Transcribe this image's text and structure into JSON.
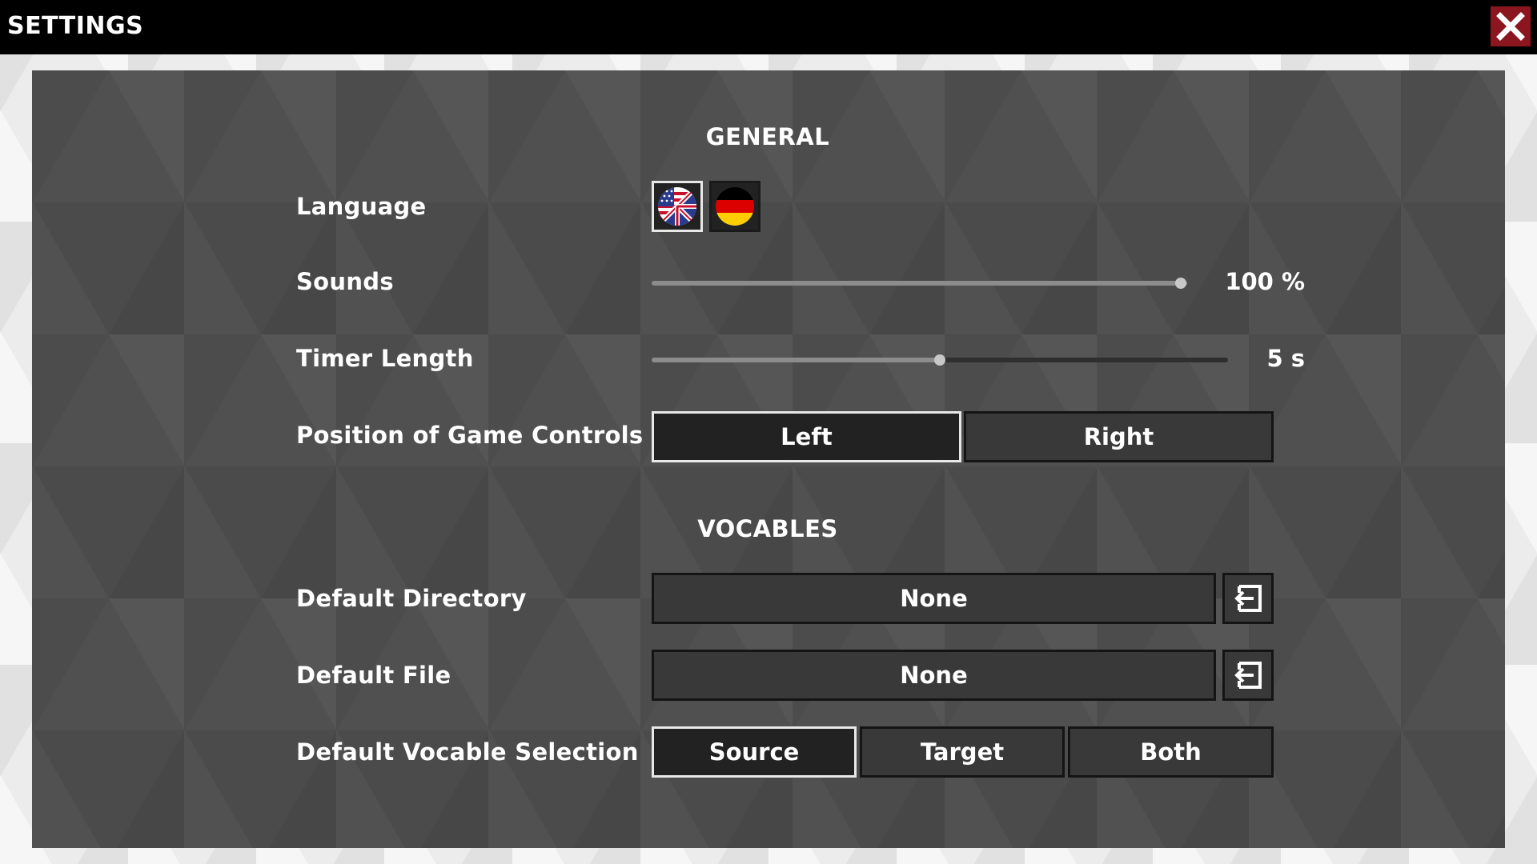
{
  "window": {
    "title": "SETTINGS",
    "close_icon": "close-icon",
    "close_color": "#8b1620"
  },
  "general": {
    "title": "GENERAL",
    "language": {
      "label": "Language",
      "options": [
        {
          "icon": "us-uk-flag-icon",
          "selected": true
        },
        {
          "icon": "german-flag-icon",
          "selected": false
        }
      ]
    },
    "sounds": {
      "label": "Sounds",
      "value_text": "100 %",
      "level": 1.0
    },
    "timer": {
      "label": "Timer Length",
      "value_text": "5 s",
      "level": 0.5
    },
    "controls_position": {
      "label": "Position of Game Controls",
      "options": [
        "Left",
        "Right"
      ],
      "selected": "Left"
    }
  },
  "vocables": {
    "title": "VOCABLES",
    "directory": {
      "label": "Default Directory",
      "value": "None",
      "icon": "open-folder-icon"
    },
    "file": {
      "label": "Default File",
      "value": "None",
      "icon": "open-file-icon"
    },
    "selection": {
      "label": "Default Vocable Selection",
      "options": [
        "Source",
        "Target",
        "Both"
      ],
      "selected": "Source"
    }
  }
}
